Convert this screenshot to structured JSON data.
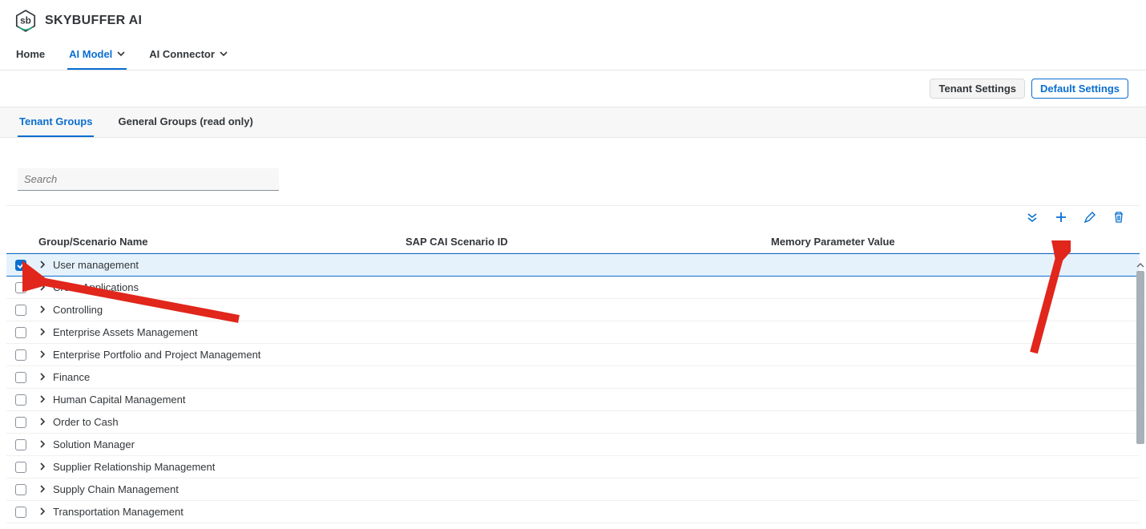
{
  "header": {
    "title": "SKYBUFFER AI",
    "logo_text": "sb"
  },
  "nav": {
    "items": [
      {
        "label": "Home",
        "active": false,
        "dropdown": false
      },
      {
        "label": "AI Model",
        "active": true,
        "dropdown": true
      },
      {
        "label": "AI Connector",
        "active": false,
        "dropdown": true
      }
    ]
  },
  "settings": {
    "tenant_label": "Tenant Settings",
    "default_label": "Default Settings"
  },
  "tabs": {
    "items": [
      {
        "label": "Tenant Groups",
        "active": true
      },
      {
        "label": "General Groups (read only)",
        "active": false
      }
    ]
  },
  "search": {
    "placeholder": "Search"
  },
  "table": {
    "columns": {
      "name": "Group/Scenario Name",
      "scenario": "SAP CAI Scenario ID",
      "memory": "Memory Parameter Value"
    },
    "rows": [
      {
        "name": "User management",
        "checked": true,
        "selected": true
      },
      {
        "name": "Cross Applications",
        "checked": false,
        "selected": false
      },
      {
        "name": "Controlling",
        "checked": false,
        "selected": false
      },
      {
        "name": "Enterprise Assets Management",
        "checked": false,
        "selected": false
      },
      {
        "name": "Enterprise Portfolio and Project Management",
        "checked": false,
        "selected": false
      },
      {
        "name": "Finance",
        "checked": false,
        "selected": false
      },
      {
        "name": "Human Capital Management",
        "checked": false,
        "selected": false
      },
      {
        "name": "Order to Cash",
        "checked": false,
        "selected": false
      },
      {
        "name": "Solution Manager",
        "checked": false,
        "selected": false
      },
      {
        "name": "Supplier Relationship Management",
        "checked": false,
        "selected": false
      },
      {
        "name": "Supply Chain Management",
        "checked": false,
        "selected": false
      },
      {
        "name": "Transportation Management",
        "checked": false,
        "selected": false
      }
    ]
  },
  "toolbar_icons": {
    "collapse": "double-chevron-down-icon",
    "add": "plus-icon",
    "edit": "pencil-icon",
    "delete": "trash-icon"
  }
}
